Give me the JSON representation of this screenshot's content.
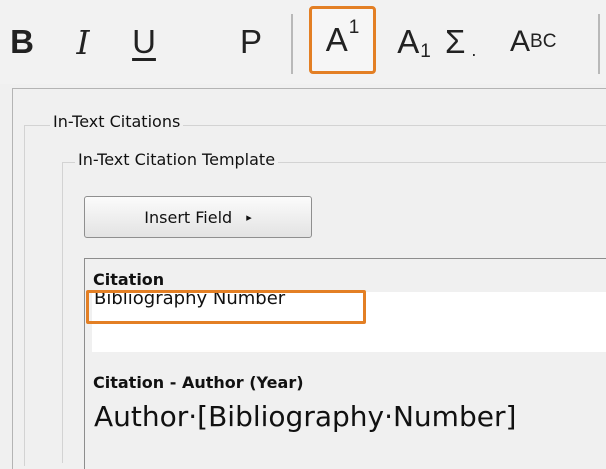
{
  "toolbar": {
    "bold_label": "B",
    "italic_label": "I",
    "underline_label": "U",
    "plain_label": "P",
    "superscript_base": "A",
    "superscript_mark": "1",
    "subscript_base": "A",
    "subscript_mark": "1",
    "symbol_label": "Σ",
    "symbol_dot": ".",
    "smallcaps_big": "A",
    "smallcaps_small": "BC",
    "highlight_color": "#e37f24"
  },
  "groups": {
    "outer_title": "In-Text Citations",
    "inner_title": "In-Text Citation Template"
  },
  "insert_field": {
    "label": "Insert Field",
    "arrow": "▸"
  },
  "entries": [
    {
      "heading": "Citation",
      "value": "Bibliography Number"
    },
    {
      "heading": "Citation - Author (Year)",
      "value": "Author·[Bibliography·Number]"
    }
  ]
}
